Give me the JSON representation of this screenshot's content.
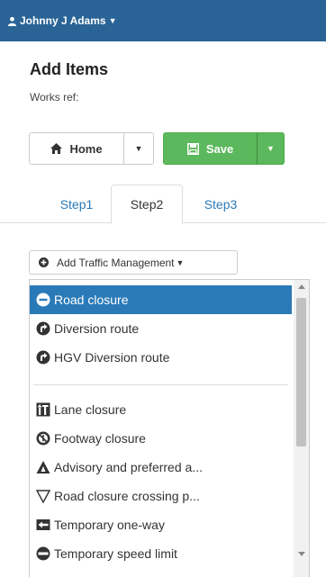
{
  "topbar": {
    "user_name": "Johnny J Adams",
    "background": "#2a6496"
  },
  "page": {
    "title": "Add Items",
    "works_ref_label": "Works ref:"
  },
  "toolbar": {
    "home_label": "Home",
    "save_label": "Save",
    "save_color": "#5cb85c"
  },
  "tabs": [
    {
      "label": "Step1",
      "active": false
    },
    {
      "label": "Step2",
      "active": true
    },
    {
      "label": "Step3",
      "active": false
    }
  ],
  "add_menu": {
    "button_label": "Add Traffic Management",
    "items": [
      {
        "label": "Road closure",
        "icon": "minus-circle-icon",
        "selected": true
      },
      {
        "label": "Diversion route",
        "icon": "diversion-icon"
      },
      {
        "label": "HGV Diversion route",
        "icon": "diversion-icon"
      },
      {
        "label": "Lane closure",
        "icon": "lane-closure-icon"
      },
      {
        "label": "Footway closure",
        "icon": "no-pedestrian-icon"
      },
      {
        "label": "Advisory and preferred a...",
        "icon": "warning-triangle-icon"
      },
      {
        "label": "Road closure crossing p...",
        "icon": "triangle-outline-icon"
      },
      {
        "label": "Temporary one-way",
        "icon": "one-way-icon"
      },
      {
        "label": "Temporary speed limit",
        "icon": "speed-limit-icon"
      }
    ]
  },
  "colors": {
    "accent": "#2a7ab8",
    "selected_item": "#2a7ab8"
  }
}
